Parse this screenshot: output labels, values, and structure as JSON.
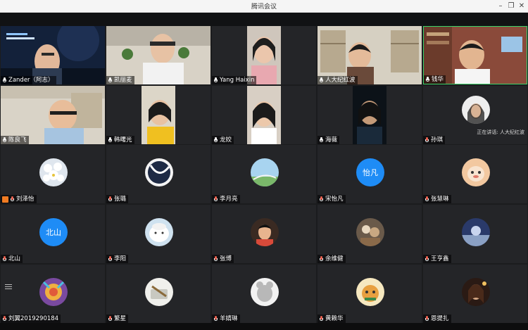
{
  "window": {
    "title": "腾讯会议"
  },
  "speaking_indicator": "正在讲话: 人大纪红波",
  "participants": [
    {
      "name": "Zander（阿志）",
      "kind": "video"
    },
    {
      "name": "凯丽麦",
      "kind": "video"
    },
    {
      "name": "Yang Haixin",
      "kind": "video"
    },
    {
      "name": "人大纪红波",
      "kind": "video"
    },
    {
      "name": "钱华",
      "kind": "video"
    },
    {
      "name": "陈良飞",
      "kind": "video"
    },
    {
      "name": "韩曙光",
      "kind": "video"
    },
    {
      "name": "龙姣",
      "kind": "video"
    },
    {
      "name": "海薇",
      "kind": "video"
    },
    {
      "name": "孙琪",
      "kind": "avatar"
    },
    {
      "name": "刘泽怡",
      "kind": "avatar"
    },
    {
      "name": "张璐",
      "kind": "avatar"
    },
    {
      "name": "李月亮",
      "kind": "avatar"
    },
    {
      "name": "宋怡凡",
      "kind": "text-avatar",
      "avatar_text": "怡凡"
    },
    {
      "name": "张慧琳",
      "kind": "avatar"
    },
    {
      "name": "北山",
      "kind": "text-avatar",
      "avatar_text": "北山"
    },
    {
      "name": "李阳",
      "kind": "avatar"
    },
    {
      "name": "张博",
      "kind": "avatar"
    },
    {
      "name": "余维健",
      "kind": "avatar"
    },
    {
      "name": "王亨鑫",
      "kind": "avatar"
    },
    {
      "name": "刘翼2019290184",
      "kind": "avatar"
    },
    {
      "name": "繁星",
      "kind": "avatar"
    },
    {
      "name": "羊婧琳",
      "kind": "avatar"
    },
    {
      "name": "黄赖华",
      "kind": "avatar"
    },
    {
      "name": "恩提扎",
      "kind": "avatar"
    }
  ],
  "colors": {
    "tile_bg": "#242528",
    "accent_blue": "#1e8cf6",
    "host_orange": "#f07b22"
  }
}
